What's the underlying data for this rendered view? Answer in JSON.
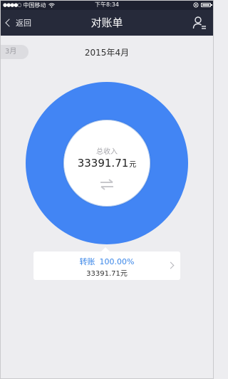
{
  "status_bar": {
    "signal": "●●●●○",
    "carrier": "中国移动",
    "time": "下午8:34"
  },
  "nav": {
    "back_label": "返回",
    "title": "对账单"
  },
  "month": {
    "previous": "3月",
    "current": "2015年4月"
  },
  "summary": {
    "label": "总收入",
    "amount": "33391.71",
    "unit": "元"
  },
  "chart_data": {
    "type": "pie",
    "categories": [
      "转账"
    ],
    "values": [
      100.0
    ],
    "colors": [
      "#4285f4"
    ]
  },
  "detail": {
    "category": "转账",
    "percent": "100.00%",
    "amount": "33391.71元"
  },
  "colors": {
    "nav_background": "#262a3a",
    "status_background": "#1e2130",
    "accent": "#4285f4",
    "page_background": "#ededf0"
  },
  "icons": {
    "back": "chevron-left-icon",
    "profile": "user-list-icon",
    "wifi": "wifi-icon",
    "battery": "battery-icon",
    "swap": "swap-arrows-icon",
    "detail": "chevron-right-icon"
  }
}
